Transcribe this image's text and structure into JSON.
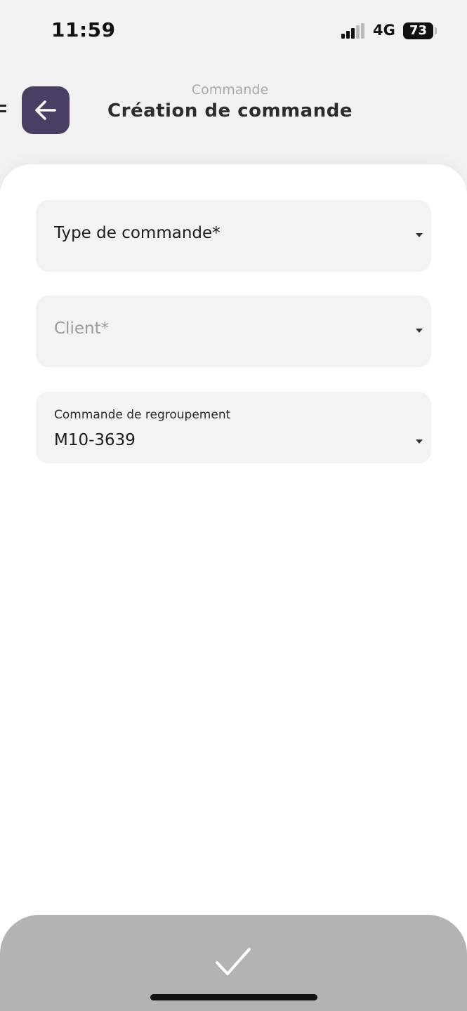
{
  "status_bar": {
    "time": "11:59",
    "network": "4G",
    "battery": "73"
  },
  "header": {
    "subtitle": "Commande",
    "title": "Création de commande",
    "back_icon": "arrow-left-icon",
    "accent_color": "#4a3f63"
  },
  "form": {
    "type_field": {
      "value": "Type de commande*",
      "icon": "chevron-down-icon"
    },
    "client_field": {
      "placeholder": "Client*",
      "icon": "chevron-down-icon"
    },
    "grouping_field": {
      "label": "Commande de regroupement",
      "value": "M10-3639",
      "icon": "chevron-down-icon"
    }
  },
  "bottom_bar": {
    "icon": "checkmark-icon",
    "color": "#b3b3b3"
  }
}
